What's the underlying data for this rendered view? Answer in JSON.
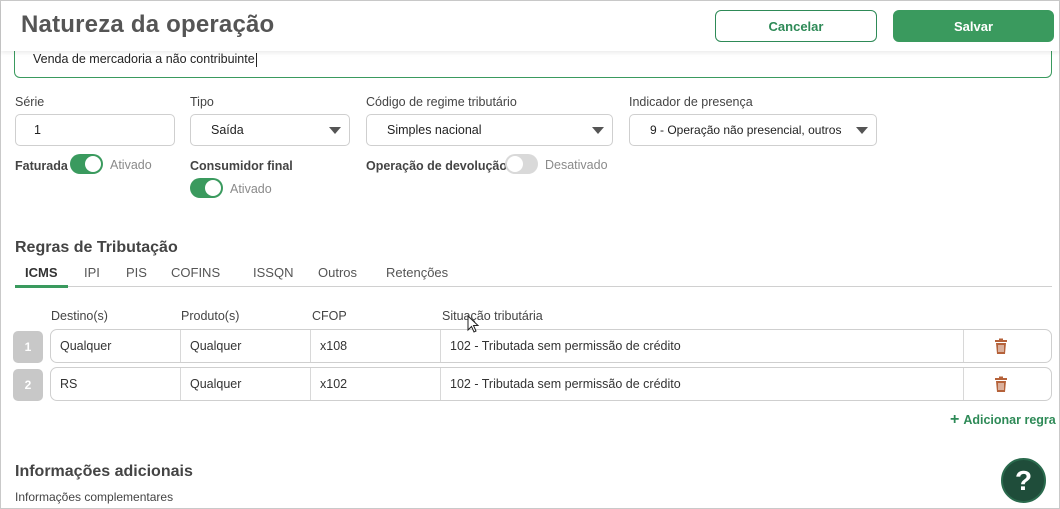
{
  "header": {
    "title": "Natureza da operação",
    "cancel_label": "Cancelar",
    "save_label": "Salvar"
  },
  "description": {
    "value": "Venda de mercadoria a não contribuinte"
  },
  "form": {
    "serie": {
      "label": "Série",
      "value": "1"
    },
    "tipo": {
      "label": "Tipo",
      "value": "Saída"
    },
    "regime": {
      "label": "Código de regime tributário",
      "value": "Simples nacional"
    },
    "presenca": {
      "label": "Indicador de presença",
      "value": "9 - Operação não presencial, outros"
    },
    "faturada": {
      "label": "Faturada",
      "state": "Ativado",
      "on": true
    },
    "consumidor": {
      "label": "Consumidor final",
      "state": "Ativado",
      "on": true
    },
    "devolucao": {
      "label": "Operação de devolução",
      "state": "Desativado",
      "on": false
    }
  },
  "regras": {
    "title": "Regras de Tributação",
    "tabs": [
      "ICMS",
      "IPI",
      "PIS",
      "COFINS",
      "ISSQN",
      "Outros",
      "Retenções"
    ],
    "active_tab": "ICMS",
    "columns": [
      "Destino(s)",
      "Produto(s)",
      "CFOP",
      "Situação tributária"
    ],
    "rows": [
      {
        "num": "1",
        "destino": "Qualquer",
        "produto": "Qualquer",
        "cfop": "x108",
        "situacao": "102 - Tributada sem permissão de crédito"
      },
      {
        "num": "2",
        "destino": "RS",
        "produto": "Qualquer",
        "cfop": "x102",
        "situacao": "102 - Tributada sem permissão de crédito"
      }
    ],
    "add_label": "Adicionar regra"
  },
  "info": {
    "title": "Informações adicionais",
    "complementares_label": "Informações complementares"
  },
  "help": {
    "label": "?"
  },
  "colors": {
    "accent": "#3a9a5e",
    "trash": "#b5623a",
    "help_bg": "#1f4d3a"
  },
  "icons": [
    "trash-icon",
    "plus-icon",
    "caret-down-icon",
    "help-icon",
    "cursor-icon"
  ]
}
